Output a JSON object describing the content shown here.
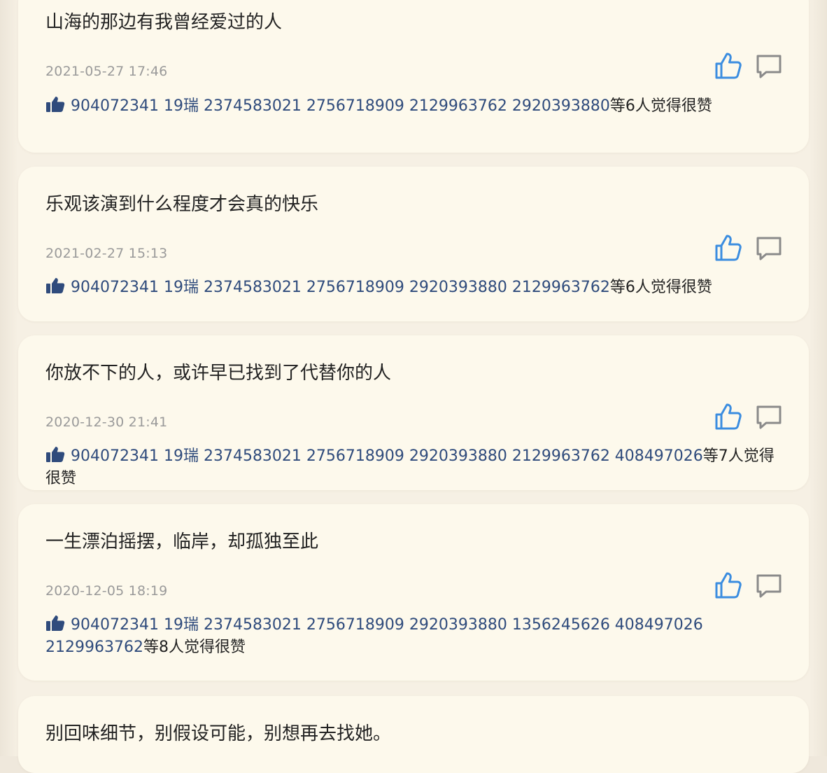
{
  "colors": {
    "page_background": "#f6f0e4",
    "card_background": "#fdf9ec",
    "text_primary": "#222222",
    "text_time": "#9a9a9a",
    "liker_names": "#2f4b7c",
    "like_icon_accent": "#3b8de0",
    "comment_icon": "#8a8a8a"
  },
  "icons": {
    "like_button": "thumbs-up-outline-icon",
    "comment_button": "speech-bubble-outline-icon",
    "likes_marker": "thumbs-up-filled-icon"
  },
  "feed": {
    "posts": [
      {
        "text": "山海的那边有我曾经爱过的人",
        "time": "2021-05-27 17:46",
        "likers": "904072341 19瑞 2374583021 2756718909 2129963762 2920393880",
        "likes_suffix": "等6人觉得很赞"
      },
      {
        "text": "乐观该演到什么程度才会真的快乐",
        "time": "2021-02-27 15:13",
        "likers": "904072341 19瑞 2374583021 2756718909 2920393880 2129963762",
        "likes_suffix": "等6人觉得很赞"
      },
      {
        "text": "你放不下的人，或许早已找到了代替你的人",
        "time": "2020-12-30 21:41",
        "likers": "904072341 19瑞 2374583021 2756718909 2920393880 2129963762 408497026",
        "likes_suffix": "等7人觉得很赞"
      },
      {
        "text": "一生漂泊摇摆，临岸，却孤独至此",
        "time": "2020-12-05 18:19",
        "likers": "904072341 19瑞 2374583021 2756718909 2920393880 1356245626 408497026 2129963762",
        "likes_suffix": "等8人觉得很赞"
      },
      {
        "text": "别回味细节，别假设可能，别想再去找她。"
      }
    ]
  }
}
